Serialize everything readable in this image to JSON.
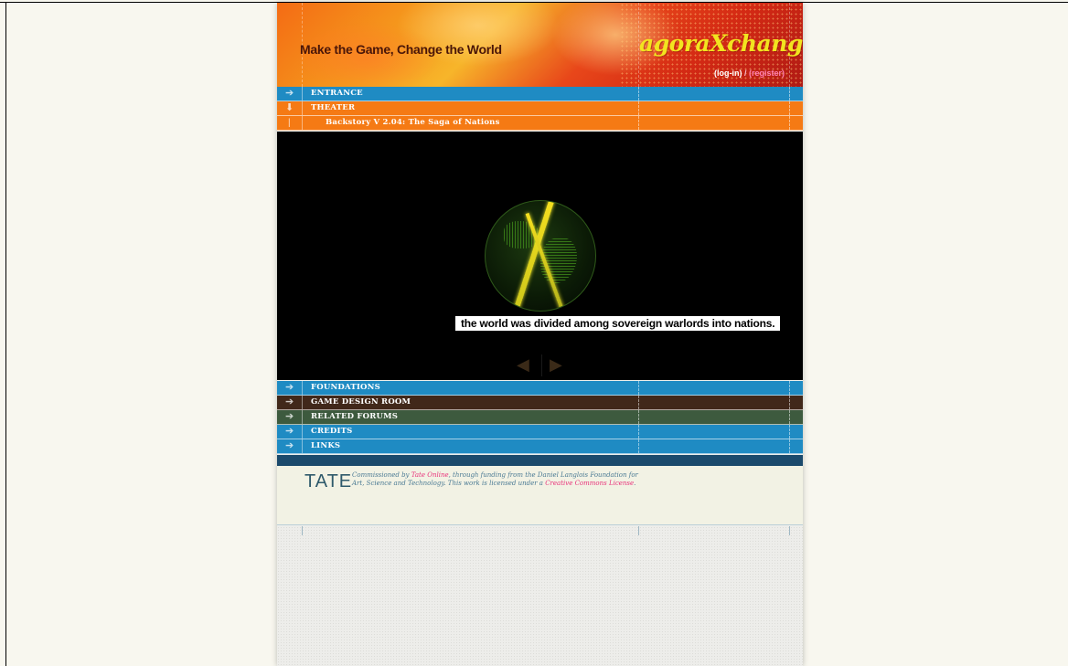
{
  "header": {
    "tagline": "Make the Game, Change the World",
    "logo": "agoraXchange",
    "login": "(log-in)",
    "separator": " / ",
    "register": "(register)"
  },
  "nav_top": [
    {
      "label": "ENTRANCE",
      "color": "#1f8bc3"
    },
    {
      "label": "THEATER",
      "color": "#f57a14"
    }
  ],
  "sub_item": {
    "label": "Backstory V 2.04: The Saga of Nations"
  },
  "video": {
    "caption": "the world was divided among sovereign warlords into nations."
  },
  "nav_bottom": [
    {
      "label": "FOUNDATIONS",
      "color": "#1f8bc3"
    },
    {
      "label": "GAME DESIGN ROOM",
      "color": "#41281a"
    },
    {
      "label": "RELATED FORUMS",
      "color": "#3d5a3e"
    },
    {
      "label": "CREDITS",
      "color": "#1f8bc3"
    },
    {
      "label": "LINKS",
      "color": "#1f8bc3"
    }
  ],
  "footer": {
    "tate": "TATE",
    "credit_pre": "Commissioned by ",
    "tate_online": "Tate Online",
    "credit_mid": ", through funding from the Daniel Langlois Foundation for Art, Science and Technology. This work is licensed under a ",
    "cc_license": "Creative Commons License",
    "credit_end": "."
  }
}
